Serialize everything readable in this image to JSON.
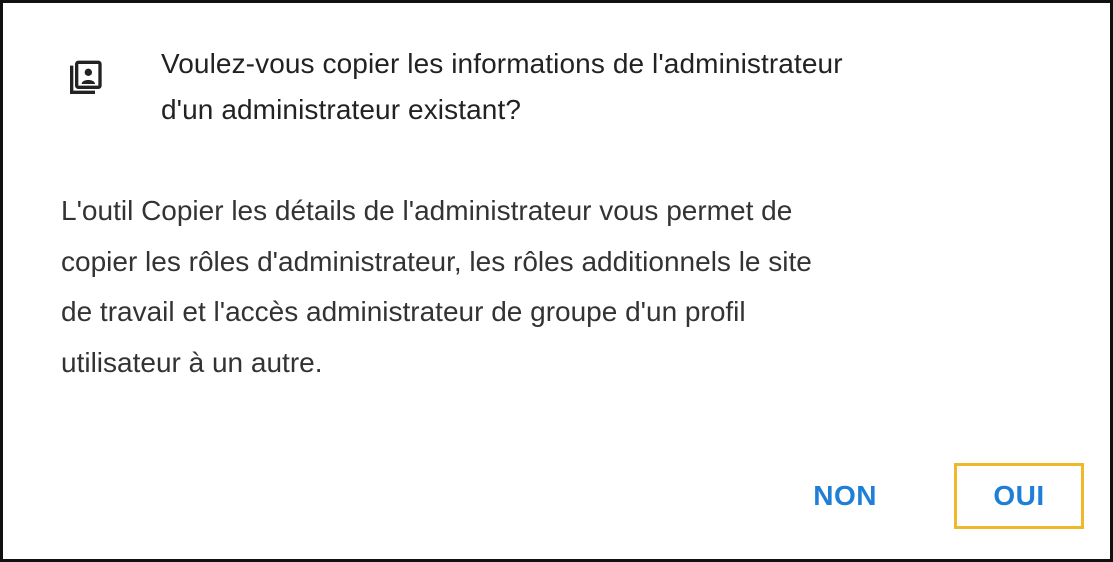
{
  "dialog": {
    "title_lines": [
      "Voulez-vous copier les informations de l'administrateur",
      "d'un administrateur existant?"
    ],
    "body_lines": [
      "L'outil Copier les détails de l'administrateur vous permet de",
      "copier les rôles d'administrateur, les rôles additionnels le site",
      "de travail et l'accès administrateur de groupe d'un profil",
      "utilisateur à un autre."
    ],
    "icon": "copy-profile-icon",
    "buttons": {
      "no_label": "NON",
      "yes_label": "OUI"
    }
  },
  "colors": {
    "accent": "#1f7fd6",
    "focus_outline": "#f0b72a",
    "border": "#111111",
    "text": "#333333"
  }
}
